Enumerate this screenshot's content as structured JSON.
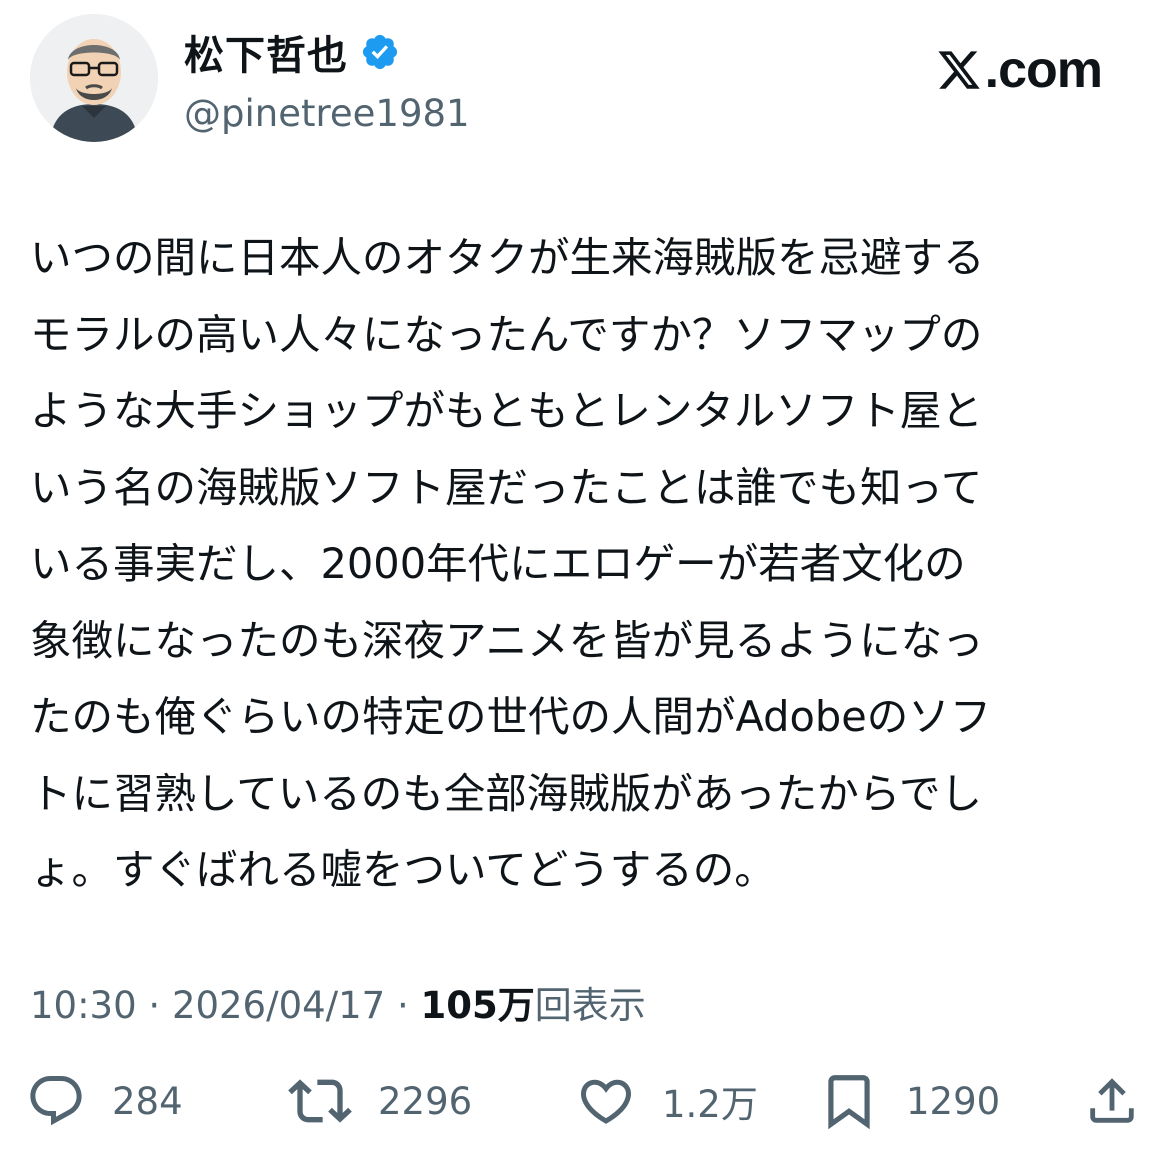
{
  "user": {
    "display_name": "松下哲也",
    "handle": "@pinetree1981",
    "verified_color": "#1d9bf0"
  },
  "brand": {
    "domain_suffix": ".com",
    "icon": "x-logo-icon"
  },
  "tweet": {
    "text": "いつの間に日本人のオタクが生来海賊版を忌避する\nモラルの高い人々になったんですか？ソフマップの\nような大手ショップがもともとレンタルソフト屋と\nいう名の海賊版ソフト屋だったことは誰でも知って\nいる事実だし、2000年代にエロゲーが若者文化の\n象徴になったのも深夜アニメを皆が見るようになっ\nたのも俺ぐらいの特定の世代の人間がAdobeのソフ\nトに習熟しているのも全部海賊版があったからでし\nょ。すぐばれる嘘をついてどうするの。"
  },
  "meta": {
    "time": "10:30",
    "separator": " · ",
    "date": "2026/04/17",
    "views_count": "105万",
    "views_label": "回表示"
  },
  "actions": {
    "replies": {
      "icon": "reply-icon",
      "count": "284"
    },
    "reposts": {
      "icon": "repost-icon",
      "count": "2296"
    },
    "likes": {
      "icon": "heart-icon",
      "count": "1.2万"
    },
    "bookmarks": {
      "icon": "bookmark-icon",
      "count": "1290"
    },
    "share": {
      "icon": "share-icon"
    }
  }
}
